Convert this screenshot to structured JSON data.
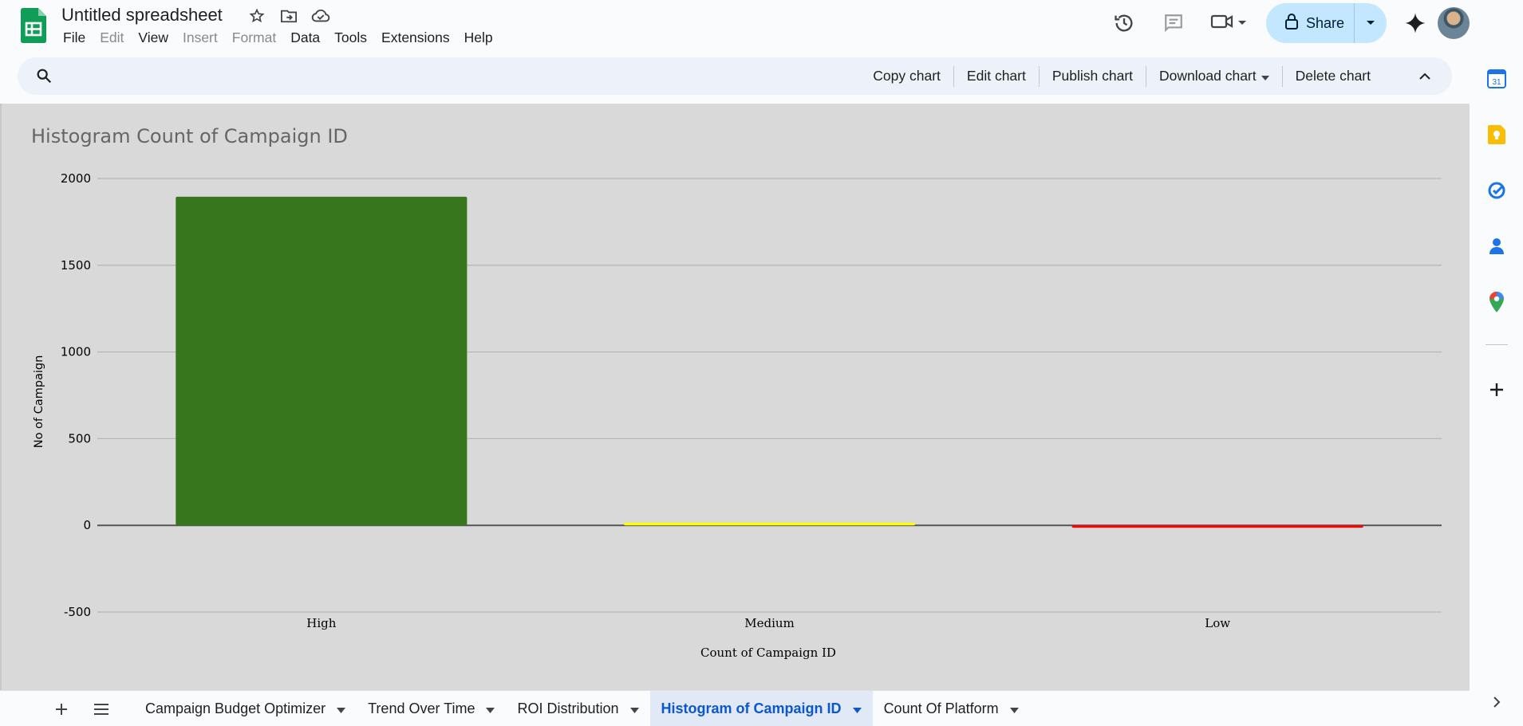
{
  "header": {
    "doc_title": "Untitled spreadsheet",
    "menu": [
      {
        "label": "File",
        "enabled": true
      },
      {
        "label": "Edit",
        "enabled": false
      },
      {
        "label": "View",
        "enabled": true
      },
      {
        "label": "Insert",
        "enabled": false
      },
      {
        "label": "Format",
        "enabled": false
      },
      {
        "label": "Data",
        "enabled": true
      },
      {
        "label": "Tools",
        "enabled": true
      },
      {
        "label": "Extensions",
        "enabled": true
      },
      {
        "label": "Help",
        "enabled": true
      }
    ],
    "share_label": "Share",
    "icons": [
      "star-icon",
      "move-folder-icon",
      "cloud-status-icon",
      "history-icon",
      "comments-icon",
      "meet-icon",
      "gemini-icon"
    ]
  },
  "chart_toolbar": {
    "copy_label": "Copy chart",
    "edit_label": "Edit chart",
    "publish_label": "Publish chart",
    "download_label": "Download chart",
    "delete_label": "Delete chart"
  },
  "chart_data": {
    "type": "bar",
    "title": "Histogram Count of Campaign ID",
    "xlabel": "Count of Campaign ID",
    "ylabel": "No of Campaign",
    "categories": [
      "High",
      "Medium",
      "Low"
    ],
    "values": [
      1895,
      15,
      -10
    ],
    "bar_colors": [
      "#38761d",
      "#ffff00",
      "#ff0000"
    ],
    "ylim": [
      -500,
      2000
    ],
    "yticks": [
      2000,
      1500,
      1000,
      500,
      0,
      -500
    ],
    "grid": true,
    "background": "#d9d9d9"
  },
  "side_panel": {
    "icons": [
      "calendar-icon",
      "keep-icon",
      "tasks-icon",
      "contacts-icon",
      "maps-icon",
      "add-icon",
      "expand-icon"
    ],
    "calendar_day": "31"
  },
  "sheet_tabs": {
    "tabs": [
      {
        "label": "Campaign Budget Optimizer",
        "active": false
      },
      {
        "label": "Trend Over Time",
        "active": false
      },
      {
        "label": "ROI Distribution",
        "active": false
      },
      {
        "label": "Histogram of Campaign ID",
        "active": true
      },
      {
        "label": "Count Of Platform",
        "active": false
      }
    ]
  },
  "colors": {
    "accent": "#0b57d0",
    "share_bg": "#c2e7ff",
    "sheets_green": "#0f9d58"
  }
}
